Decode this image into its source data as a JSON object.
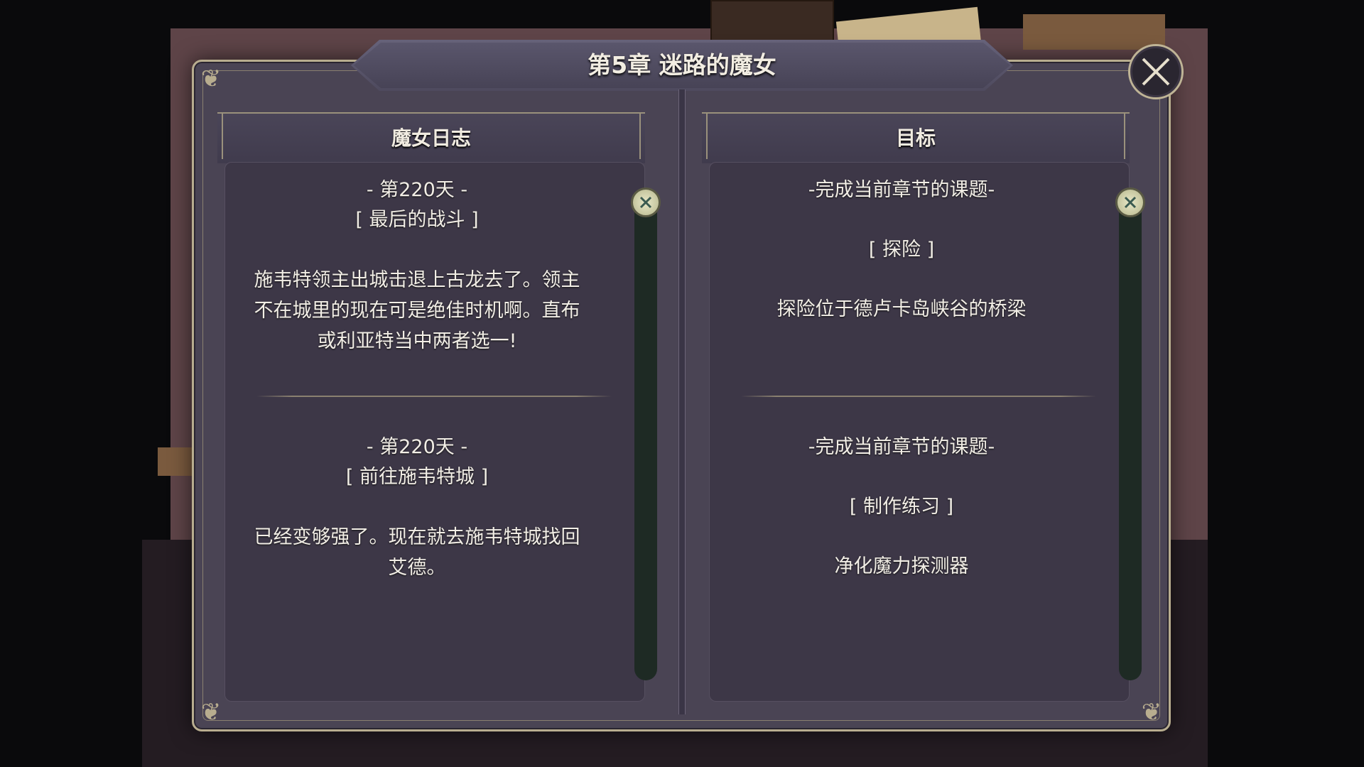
{
  "title": "第5章  迷路的魔女",
  "close_icon": "close-x-icon",
  "columns": [
    {
      "header": "魔女日志",
      "entries": [
        {
          "day": "- 第220天 -",
          "subtitle": "[ 最后的战斗 ]",
          "body": "施韦特领主出城击退上古龙去了。领主不在城里的现在可是绝佳时机啊。直布或利亚特当中两者选一!"
        },
        {
          "day": "- 第220天 -",
          "subtitle": "[ 前往施韦特城 ]",
          "body": "已经变够强了。现在就去施韦特城找回艾德。"
        }
      ]
    },
    {
      "header": "目标",
      "entries": [
        {
          "heading": "-完成当前章节的课题-",
          "task": "[ 探险 ]",
          "detail": "探险位于德卢卡岛峡谷的桥梁"
        },
        {
          "heading": "-完成当前章节的课题-",
          "task": "[ 制作练习 ]",
          "detail": "净化魔力探测器"
        }
      ]
    }
  ],
  "colors": {
    "panel": "#4a4454",
    "border": "#b8ad8f",
    "text": "#f2eee6",
    "scroll_track": "#1e2a24"
  }
}
